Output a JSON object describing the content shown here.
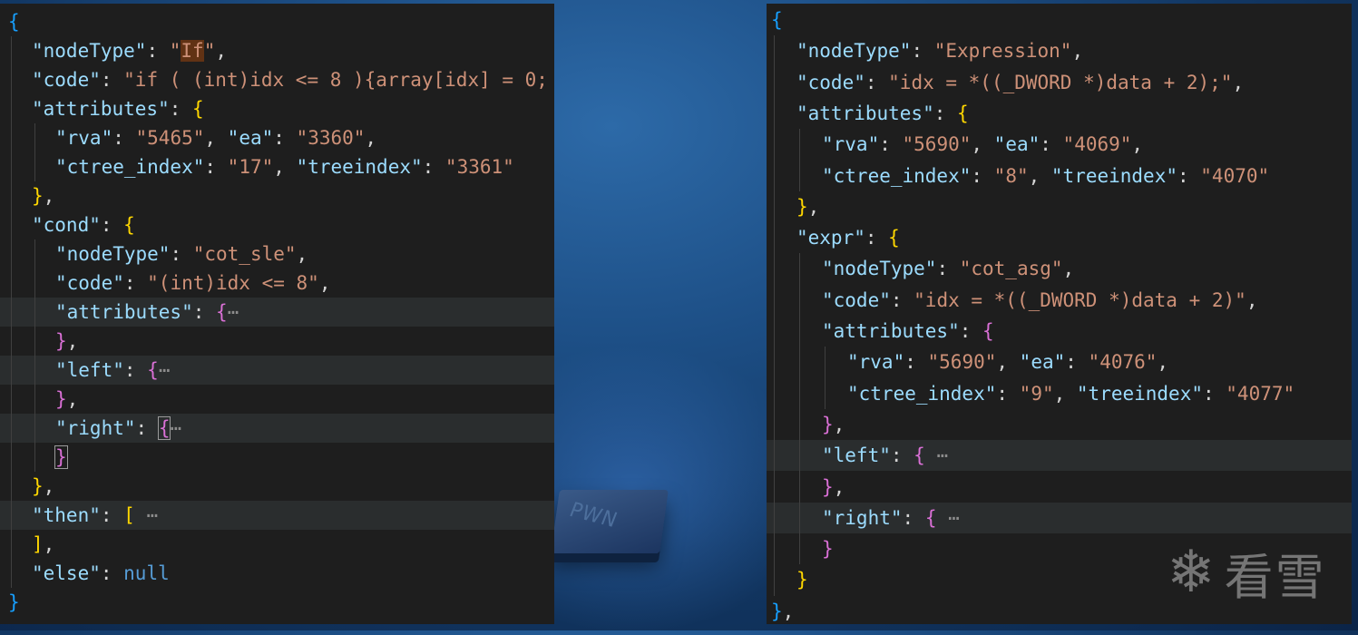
{
  "left_editor": {
    "lines": [
      {
        "indent": 0,
        "parts": [
          [
            "b0",
            "{"
          ]
        ]
      },
      {
        "indent": 1,
        "parts": [
          [
            "k",
            "\"nodeType\""
          ],
          [
            "p",
            ": "
          ],
          [
            "s",
            "\""
          ],
          [
            "s sel",
            "If"
          ],
          [
            "s",
            "\""
          ],
          [
            "p",
            ","
          ]
        ]
      },
      {
        "indent": 1,
        "parts": [
          [
            "k",
            "\"code\""
          ],
          [
            "p",
            ": "
          ],
          [
            "s",
            "\"if ( (int)idx <= 8 ){array[idx] = 0;"
          ]
        ]
      },
      {
        "indent": 1,
        "parts": [
          [
            "k",
            "\"attributes\""
          ],
          [
            "p",
            ": "
          ],
          [
            "b1",
            "{"
          ]
        ]
      },
      {
        "indent": 2,
        "parts": [
          [
            "k",
            "\"rva\""
          ],
          [
            "p",
            ": "
          ],
          [
            "s",
            "\"5465\""
          ],
          [
            "p",
            ", "
          ],
          [
            "k",
            "\"ea\""
          ],
          [
            "p",
            ": "
          ],
          [
            "s",
            "\"3360\""
          ],
          [
            "p",
            ","
          ]
        ]
      },
      {
        "indent": 2,
        "parts": [
          [
            "k",
            "\"ctree_index\""
          ],
          [
            "p",
            ": "
          ],
          [
            "s",
            "\"17\""
          ],
          [
            "p",
            ", "
          ],
          [
            "k",
            "\"treeindex\""
          ],
          [
            "p",
            ": "
          ],
          [
            "s",
            "\"3361\""
          ]
        ]
      },
      {
        "indent": 1,
        "parts": [
          [
            "b1",
            "}"
          ],
          [
            "p",
            ","
          ]
        ]
      },
      {
        "indent": 1,
        "parts": [
          [
            "k",
            "\"cond\""
          ],
          [
            "p",
            ": "
          ],
          [
            "b1",
            "{"
          ]
        ]
      },
      {
        "indent": 2,
        "parts": [
          [
            "k",
            "\"nodeType\""
          ],
          [
            "p",
            ": "
          ],
          [
            "s",
            "\"cot_sle\""
          ],
          [
            "p",
            ","
          ]
        ]
      },
      {
        "indent": 2,
        "parts": [
          [
            "k",
            "\"code\""
          ],
          [
            "p",
            ": "
          ],
          [
            "s",
            "\"(int)idx <= 8\""
          ],
          [
            "p",
            ","
          ]
        ]
      },
      {
        "indent": 2,
        "hl": true,
        "parts": [
          [
            "k",
            "\"attributes\""
          ],
          [
            "p",
            ": "
          ],
          [
            "b2",
            "{"
          ],
          [
            "fold",
            "⋯"
          ]
        ]
      },
      {
        "indent": 2,
        "parts": [
          [
            "b2",
            "}"
          ],
          [
            "p",
            ","
          ]
        ]
      },
      {
        "indent": 2,
        "hl": true,
        "parts": [
          [
            "k",
            "\"left\""
          ],
          [
            "p",
            ": "
          ],
          [
            "b2",
            "{"
          ],
          [
            "fold",
            "⋯"
          ]
        ]
      },
      {
        "indent": 2,
        "parts": [
          [
            "b2",
            "}"
          ],
          [
            "p",
            ","
          ]
        ]
      },
      {
        "indent": 2,
        "hl": true,
        "parts": [
          [
            "k",
            "\"right\""
          ],
          [
            "p",
            ": "
          ],
          [
            "b2 cursor-box",
            "{"
          ],
          [
            "fold",
            "⋯"
          ]
        ]
      },
      {
        "indent": 2,
        "parts": [
          [
            "b2 cursor-box",
            "}"
          ]
        ]
      },
      {
        "indent": 1,
        "parts": [
          [
            "b1",
            "}"
          ],
          [
            "p",
            ","
          ]
        ]
      },
      {
        "indent": 1,
        "hl": true,
        "parts": [
          [
            "k",
            "\"then\""
          ],
          [
            "p",
            ": "
          ],
          [
            "b1",
            "["
          ],
          [
            "fold",
            " ⋯"
          ]
        ]
      },
      {
        "indent": 1,
        "parts": [
          [
            "b1",
            "]"
          ],
          [
            "p",
            ","
          ]
        ]
      },
      {
        "indent": 1,
        "parts": [
          [
            "k",
            "\"else\""
          ],
          [
            "p",
            ": "
          ],
          [
            "kw",
            "null"
          ]
        ]
      },
      {
        "indent": 0,
        "parts": [
          [
            "b0",
            "}"
          ]
        ]
      }
    ]
  },
  "right_editor": {
    "lines": [
      {
        "indent": 0,
        "parts": [
          [
            "b0",
            "{"
          ]
        ]
      },
      {
        "indent": 1,
        "parts": [
          [
            "k",
            "\"nodeType\""
          ],
          [
            "p",
            ": "
          ],
          [
            "s",
            "\"Expression\""
          ],
          [
            "p",
            ","
          ]
        ]
      },
      {
        "indent": 1,
        "parts": [
          [
            "k",
            "\"code\""
          ],
          [
            "p",
            ": "
          ],
          [
            "s",
            "\"idx = *((_DWORD *)data + 2);\""
          ],
          [
            "p",
            ","
          ]
        ]
      },
      {
        "indent": 1,
        "parts": [
          [
            "k",
            "\"attributes\""
          ],
          [
            "p",
            ": "
          ],
          [
            "b1",
            "{"
          ]
        ]
      },
      {
        "indent": 2,
        "parts": [
          [
            "k",
            "\"rva\""
          ],
          [
            "p",
            ": "
          ],
          [
            "s",
            "\"5690\""
          ],
          [
            "p",
            ", "
          ],
          [
            "k",
            "\"ea\""
          ],
          [
            "p",
            ": "
          ],
          [
            "s",
            "\"4069\""
          ],
          [
            "p",
            ","
          ]
        ]
      },
      {
        "indent": 2,
        "parts": [
          [
            "k",
            "\"ctree_index\""
          ],
          [
            "p",
            ": "
          ],
          [
            "s",
            "\"8\""
          ],
          [
            "p",
            ", "
          ],
          [
            "k",
            "\"treeindex\""
          ],
          [
            "p",
            ": "
          ],
          [
            "s",
            "\"4070\""
          ]
        ]
      },
      {
        "indent": 1,
        "parts": [
          [
            "b1",
            "}"
          ],
          [
            "p",
            ","
          ]
        ]
      },
      {
        "indent": 1,
        "parts": [
          [
            "k",
            "\"expr\""
          ],
          [
            "p",
            ": "
          ],
          [
            "b1",
            "{"
          ]
        ]
      },
      {
        "indent": 2,
        "parts": [
          [
            "k",
            "\"nodeType\""
          ],
          [
            "p",
            ": "
          ],
          [
            "s",
            "\"cot_asg\""
          ],
          [
            "p",
            ","
          ]
        ]
      },
      {
        "indent": 2,
        "parts": [
          [
            "k",
            "\"code\""
          ],
          [
            "p",
            ": "
          ],
          [
            "s",
            "\"idx = *((_DWORD *)data + 2)\""
          ],
          [
            "p",
            ","
          ]
        ]
      },
      {
        "indent": 2,
        "parts": [
          [
            "k",
            "\"attributes\""
          ],
          [
            "p",
            ": "
          ],
          [
            "b2",
            "{"
          ]
        ]
      },
      {
        "indent": 3,
        "parts": [
          [
            "k",
            "\"rva\""
          ],
          [
            "p",
            ": "
          ],
          [
            "s",
            "\"5690\""
          ],
          [
            "p",
            ", "
          ],
          [
            "k",
            "\"ea\""
          ],
          [
            "p",
            ": "
          ],
          [
            "s",
            "\"4076\""
          ],
          [
            "p",
            ","
          ]
        ]
      },
      {
        "indent": 3,
        "parts": [
          [
            "k",
            "\"ctree_index\""
          ],
          [
            "p",
            ": "
          ],
          [
            "s",
            "\"9\""
          ],
          [
            "p",
            ", "
          ],
          [
            "k",
            "\"treeindex\""
          ],
          [
            "p",
            ": "
          ],
          [
            "s",
            "\"4077\""
          ]
        ]
      },
      {
        "indent": 2,
        "parts": [
          [
            "b2",
            "}"
          ],
          [
            "p",
            ","
          ]
        ]
      },
      {
        "indent": 2,
        "hl": true,
        "parts": [
          [
            "k",
            "\"left\""
          ],
          [
            "p",
            ": "
          ],
          [
            "b2",
            "{"
          ],
          [
            "fold",
            " ⋯"
          ]
        ]
      },
      {
        "indent": 2,
        "parts": [
          [
            "b2",
            "}"
          ],
          [
            "p",
            ","
          ]
        ]
      },
      {
        "indent": 2,
        "hl": true,
        "parts": [
          [
            "k",
            "\"right\""
          ],
          [
            "p",
            ": "
          ],
          [
            "b2",
            "{"
          ],
          [
            "fold",
            " ⋯"
          ]
        ]
      },
      {
        "indent": 2,
        "parts": [
          [
            "b2",
            "}"
          ]
        ]
      },
      {
        "indent": 1,
        "parts": [
          [
            "b1",
            "}"
          ]
        ]
      },
      {
        "indent": 0,
        "parts": [
          [
            "b0",
            "}"
          ],
          [
            "p",
            ","
          ]
        ]
      }
    ]
  },
  "background": {
    "chip_label": "PWN"
  },
  "watermark": {
    "icon": "snowflake-icon",
    "text": "看雪"
  }
}
